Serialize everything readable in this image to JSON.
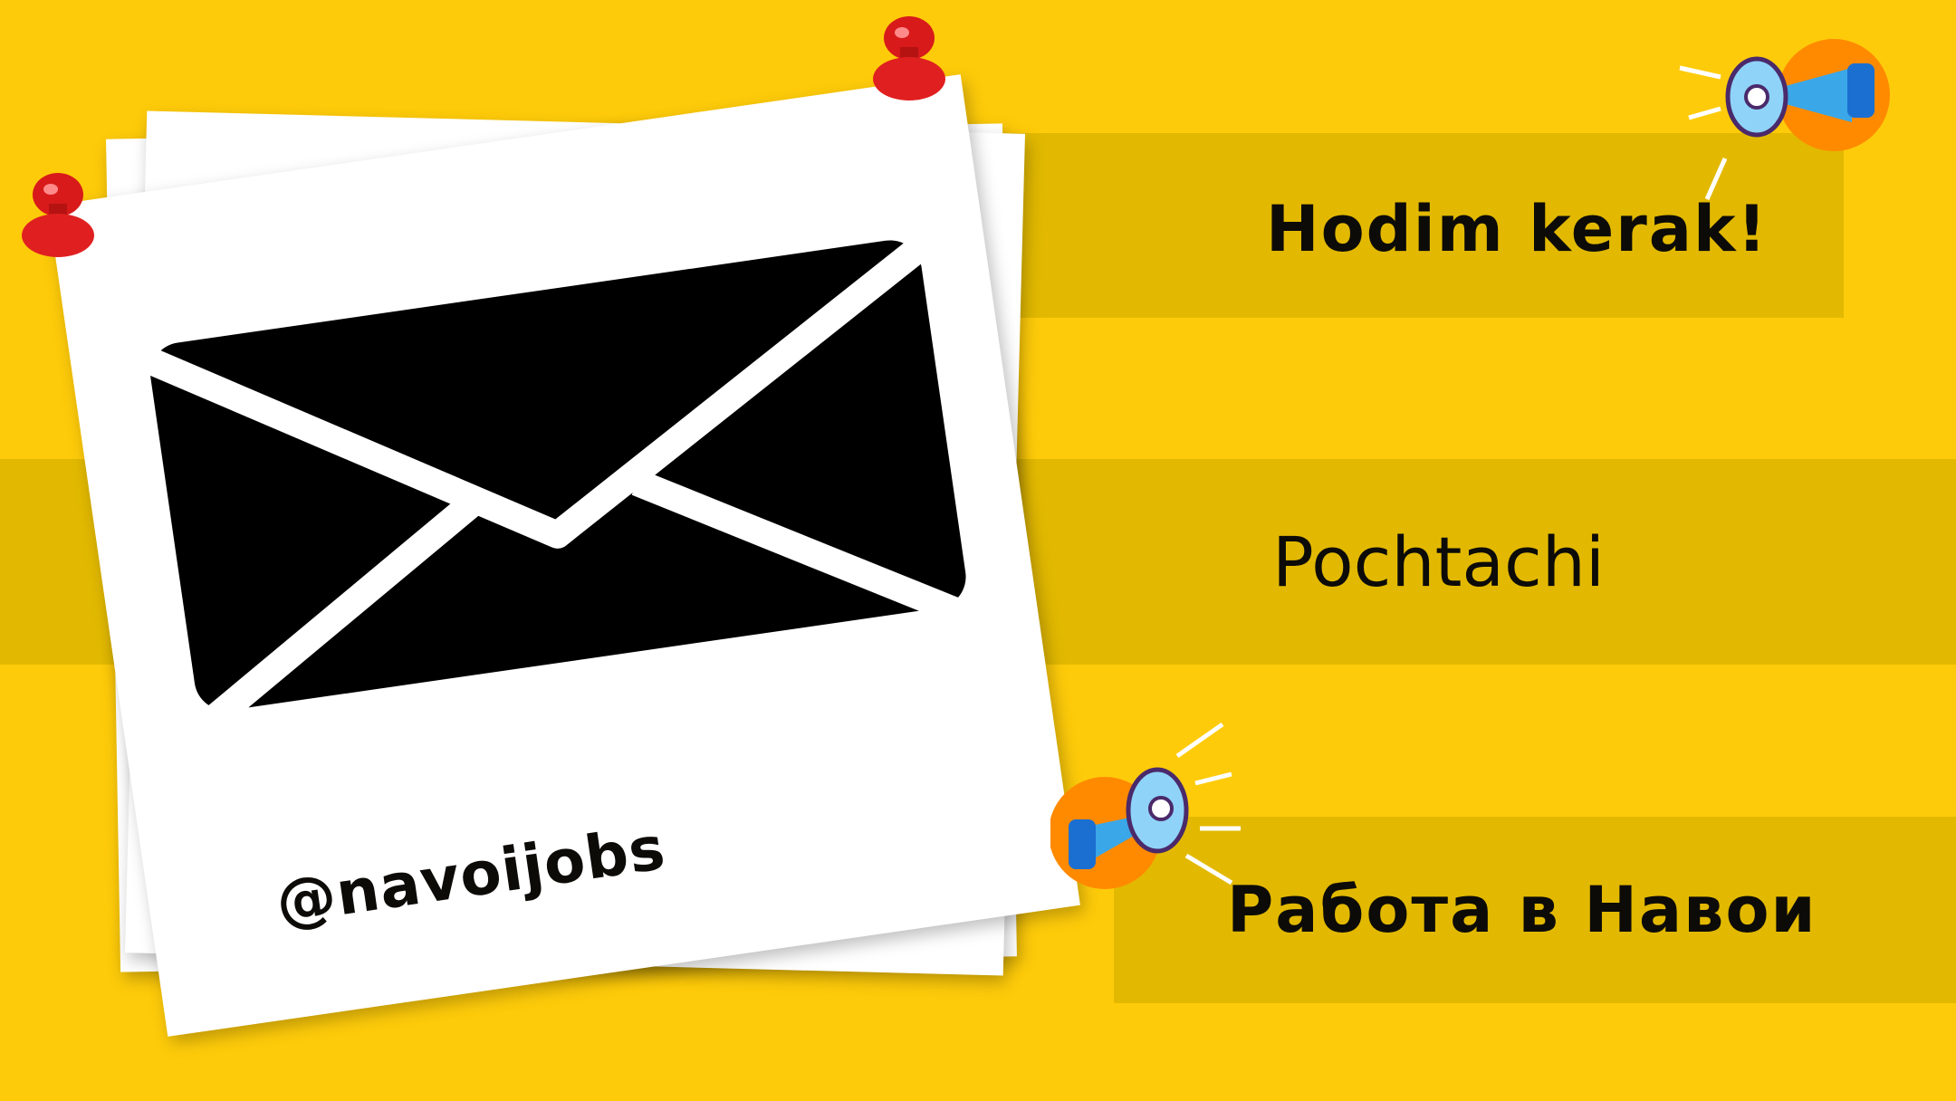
{
  "headline": "Hodim kerak!",
  "job_title": "Pochtachi",
  "location_ru": "Работа в Навои",
  "handle": "@navoijobs",
  "icons": [
    "envelope-icon",
    "pushpin-icon",
    "megaphone-icon"
  ],
  "colors": {
    "background": "#fecb0a",
    "band": "#e2b900",
    "text": "#0d0b08",
    "pin": "#d81a1a",
    "megaphone": "#3aa7e8",
    "megaphone_circle": "#ff8a00"
  }
}
